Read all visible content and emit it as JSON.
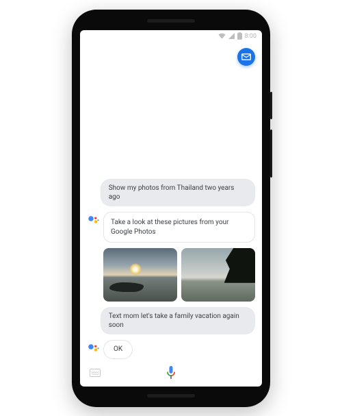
{
  "statusbar": {
    "time": "8:00"
  },
  "conversation": {
    "user1": "Show my photos from Thailand two years ago",
    "asst1": "Take a look at these pictures from your Google Photos",
    "user2": "Text mom let's take a family vacation again soon",
    "asst2": "OK"
  },
  "colors": {
    "accent": "#1a73e8",
    "g_blue": "#4285F4",
    "g_red": "#EA4335",
    "g_yellow": "#FBBC05",
    "g_green": "#34A853"
  }
}
